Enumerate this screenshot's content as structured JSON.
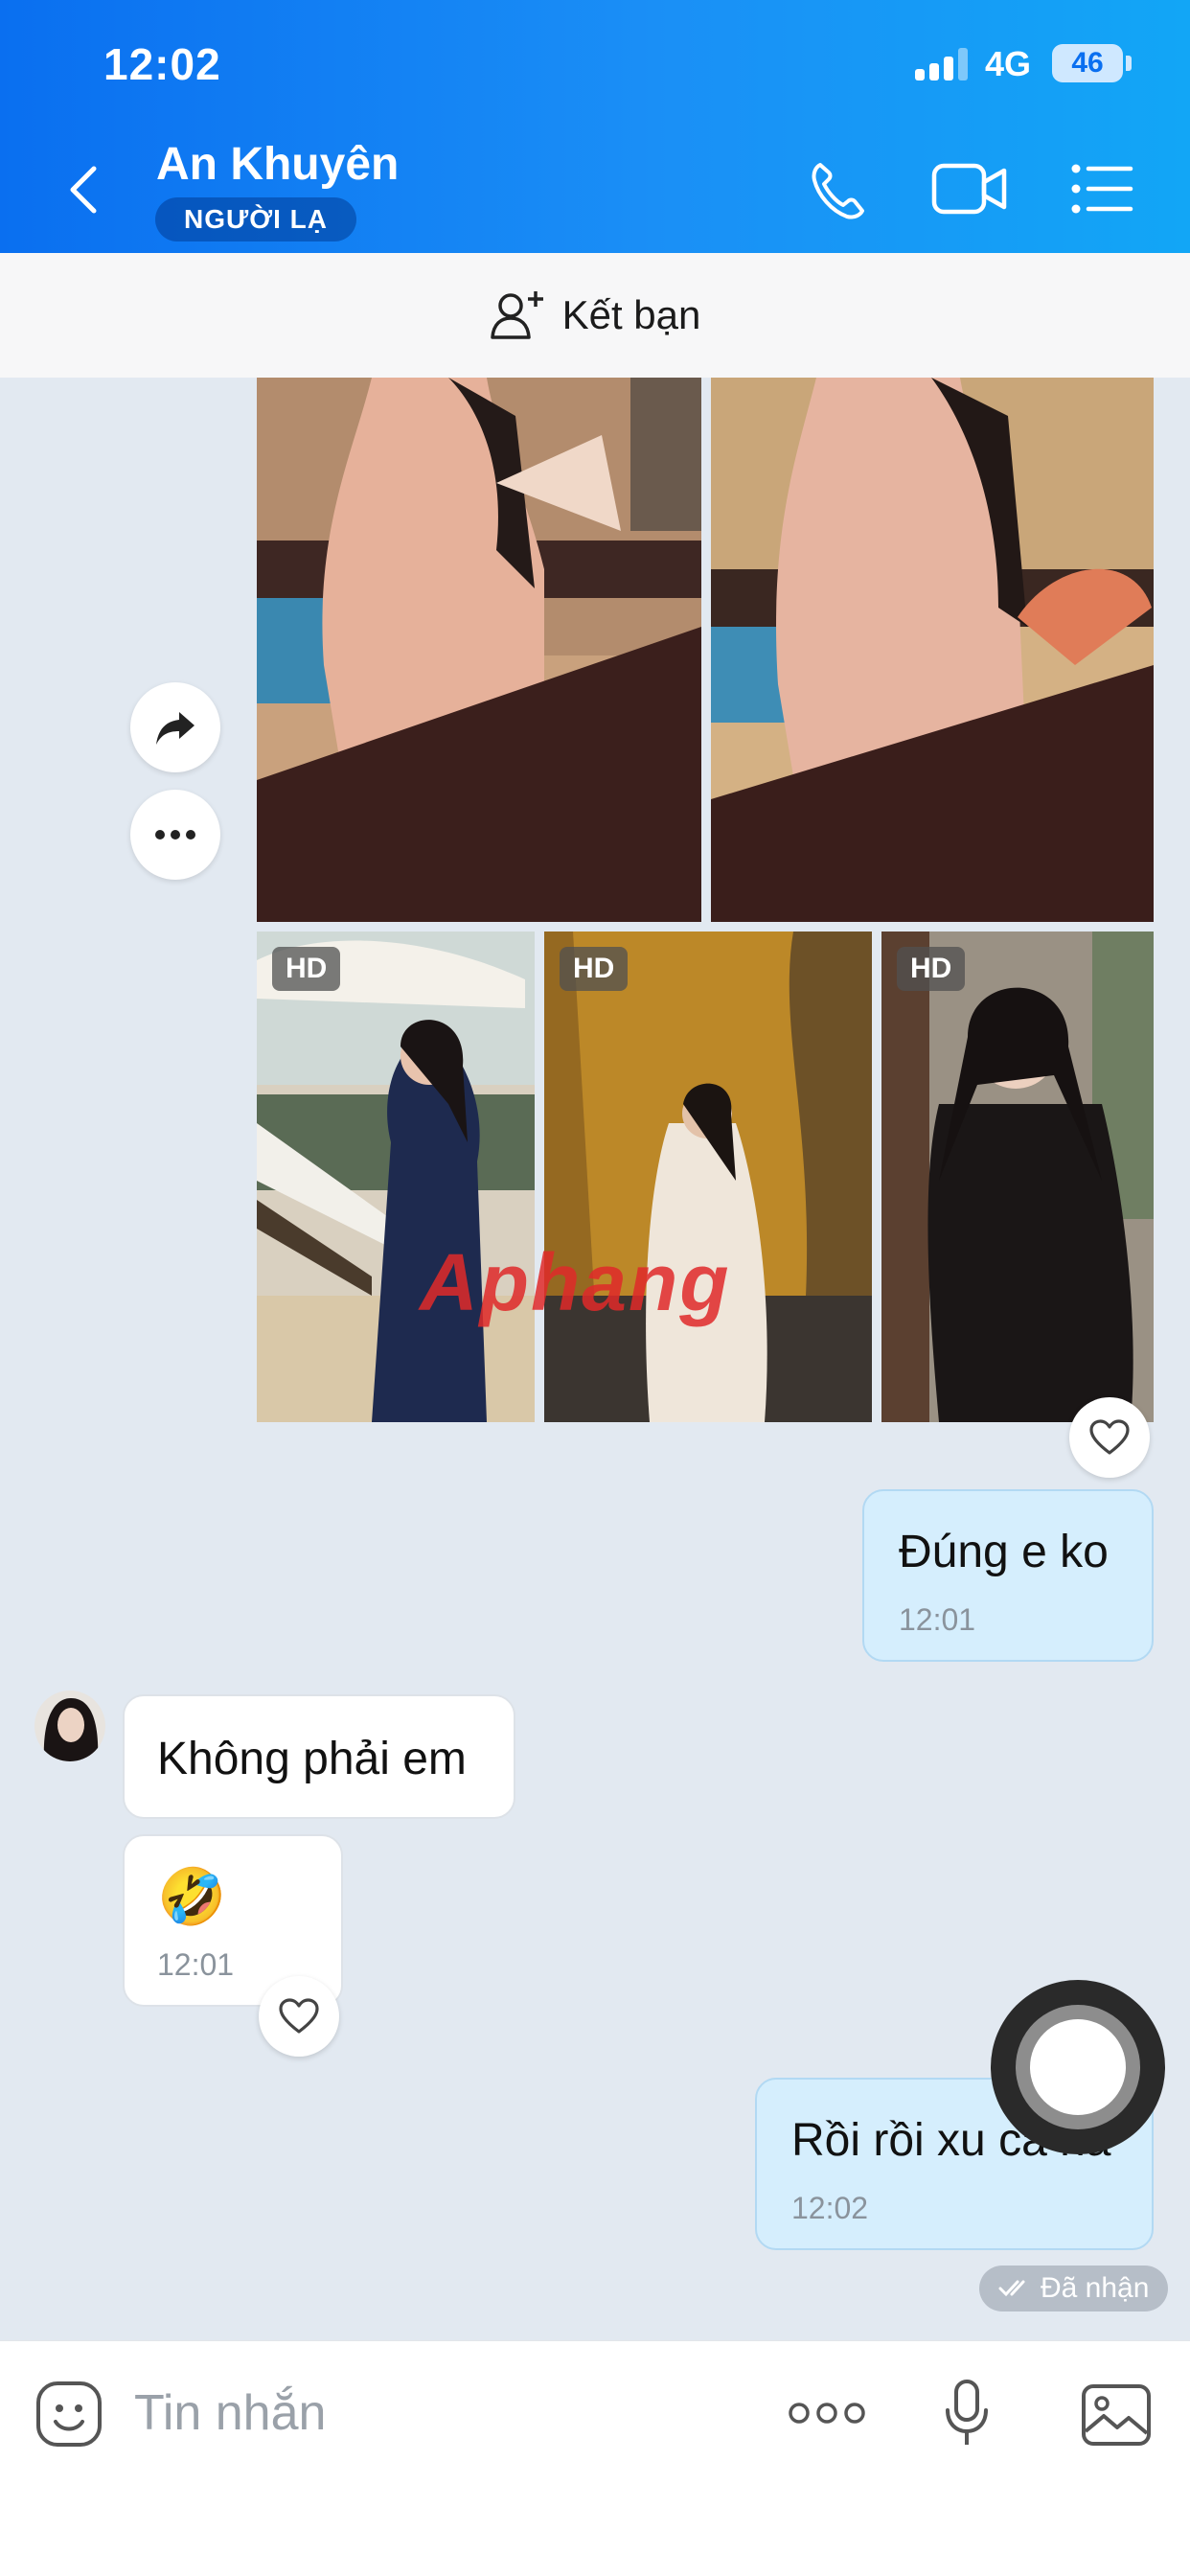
{
  "status_bar": {
    "time": "12:02",
    "network": "4G",
    "battery": "46"
  },
  "header": {
    "contact_name": "An Khuyên",
    "badge": "NGƯỜI LẠ"
  },
  "add_friend": {
    "label": "Kết bạn"
  },
  "photos": {
    "hd_label": "HD"
  },
  "watermark": "Aphang",
  "messages": {
    "m1": {
      "text": "Đúng e ko",
      "time": "12:01"
    },
    "m2": {
      "text": "Không phải em"
    },
    "m3": {
      "text": "🤣",
      "time": "12:01"
    },
    "m4": {
      "text": "Rồi rồi xu ca na",
      "time": "12:02"
    }
  },
  "status": {
    "received": "Đã nhận"
  },
  "composer": {
    "placeholder": "Tin nhắn"
  },
  "colors": {
    "header_start": "#0a6ff0",
    "header_end": "#12a6f6",
    "outgoing_bubble": "#d5eefd",
    "background": "#e2e9f1"
  }
}
